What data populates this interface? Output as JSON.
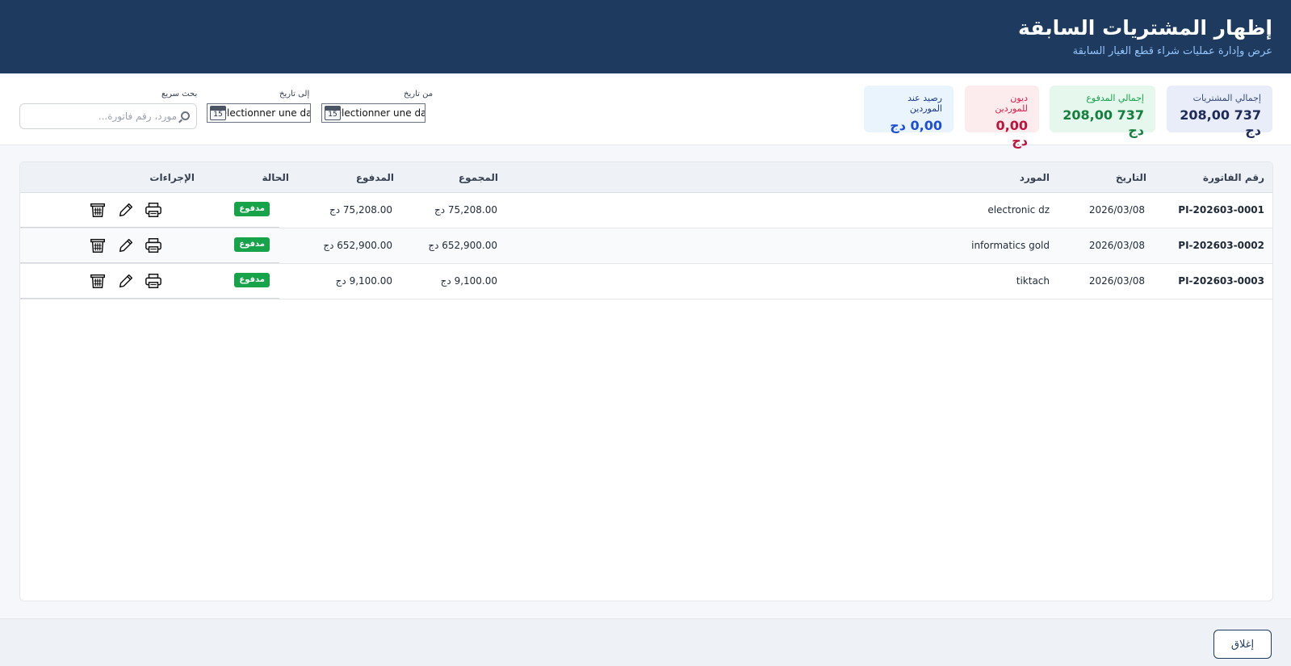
{
  "header": {
    "title": "إظهار المشتريات السابقة",
    "subtitle": "عرض وإدارة عمليات شراء قطع الغيار السابقة"
  },
  "summary": [
    {
      "label": "إجمالي المشتريات",
      "value": "737 208,00 دج"
    },
    {
      "label": "إجمالي المدفوع",
      "value": "737 208,00 دج"
    },
    {
      "label": "ديون للموردين",
      "value": "0,00 دج"
    },
    {
      "label": "رصيد عند الموردين",
      "value": "0,00 دج"
    }
  ],
  "filters": {
    "from_label": "من تاريخ",
    "to_label": "إلى تاريخ",
    "date_placeholder": "Sélectionner une date",
    "calendar_day": "15",
    "search_label": "بحث سريع",
    "search_placeholder": "مورد، رقم فاتورة..."
  },
  "table": {
    "columns": {
      "invoice": "رقم الفاتورة",
      "date": "التاريخ",
      "supplier": "المورد",
      "total": "المجموع",
      "paid": "المدفوع",
      "status": "الحالة",
      "actions": "الإجراءات"
    },
    "rows": [
      {
        "invoice": "PI-202603-0001",
        "date": "2026/03/08",
        "supplier": "electronic dz",
        "total": "75,208.00 دج",
        "paid": "75,208.00 دج",
        "status": "مدفوع"
      },
      {
        "invoice": "PI-202603-0002",
        "date": "2026/03/08",
        "supplier": "informatics gold",
        "total": "652,900.00 دج",
        "paid": "652,900.00 دج",
        "status": "مدفوع"
      },
      {
        "invoice": "PI-202603-0003",
        "date": "2026/03/08",
        "supplier": "tiktach",
        "total": "9,100.00 دج",
        "paid": "9,100.00 دج",
        "status": "مدفوع"
      }
    ],
    "row_actions": [
      "print-icon",
      "edit-icon",
      "delete-icon"
    ]
  },
  "footer": {
    "close_label": "إغلاق"
  },
  "colors": {
    "header_bg": "#1e3a5f",
    "status_paid": "#16a34a"
  }
}
